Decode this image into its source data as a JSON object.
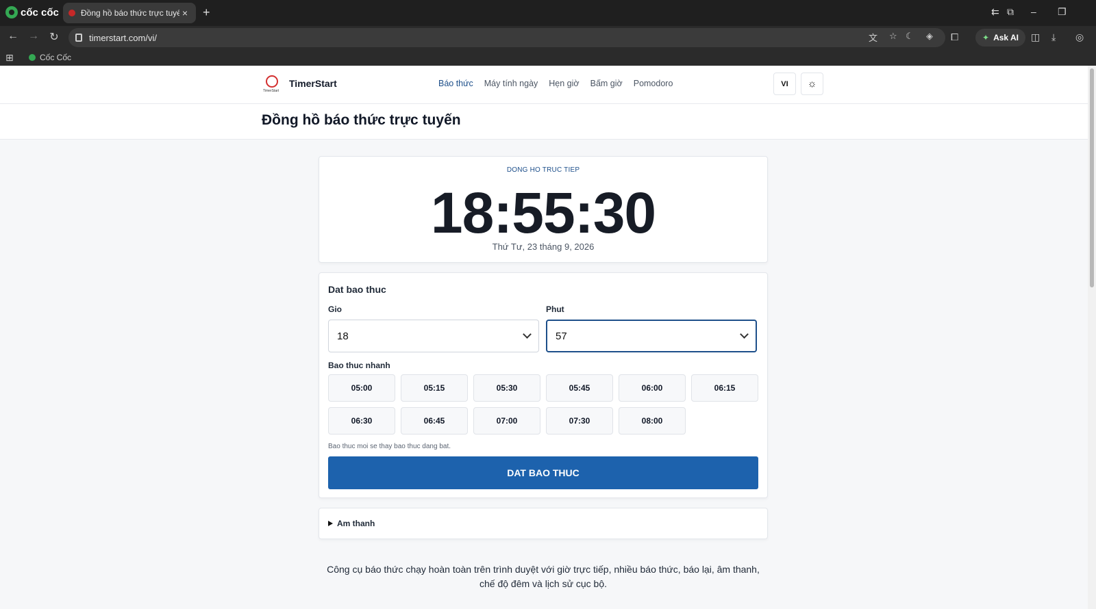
{
  "browser": {
    "brand": "cốc cốc",
    "tab_title": "Đồng hồ báo thức trực tuyến",
    "tab_close": "×",
    "new_tab": "+",
    "url": "timerstart.com/vi/",
    "ask_ai": "Ask AI",
    "bookmark": "Cốc Cốc"
  },
  "site": {
    "name": "TimerStart",
    "logo_text": "TimerStart",
    "nav": [
      {
        "label": "Báo thức",
        "active": true
      },
      {
        "label": "Máy tính ngày"
      },
      {
        "label": "Hẹn giờ"
      },
      {
        "label": "Bấm giờ"
      },
      {
        "label": "Pomodoro"
      }
    ],
    "lang_button": "VI"
  },
  "page": {
    "title": "Đồng hồ báo thức trực tuyến"
  },
  "clock": {
    "label": "DONG HO TRUC TIEP",
    "time": "18:55:30",
    "date": "Thứ Tư, 23 tháng 9, 2026"
  },
  "alarm": {
    "title": "Dat bao thuc",
    "hour_label": "Gio",
    "hour_value": "18",
    "minute_label": "Phut",
    "minute_value": "57",
    "quick_label": "Bao thuc nhanh",
    "quick_times": [
      "05:00",
      "05:15",
      "05:30",
      "05:45",
      "06:00",
      "06:15",
      "06:30",
      "06:45",
      "07:00",
      "07:30",
      "08:00"
    ],
    "hint": "Bao thuc moi se thay bao thuc dang bat.",
    "submit_label": "DAT BAO THUC"
  },
  "sound": {
    "label": "Am thanh"
  },
  "description": "Công cụ báo thức chạy hoàn toàn trên trình duyệt với giờ trực tiếp, nhiều báo thức, báo lại, âm thanh, chế độ đêm và lịch sử cục bộ.",
  "colors": {
    "accent": "#1d62ad",
    "nav_active": "#1d4f8a",
    "clock_text": "#171c26"
  }
}
